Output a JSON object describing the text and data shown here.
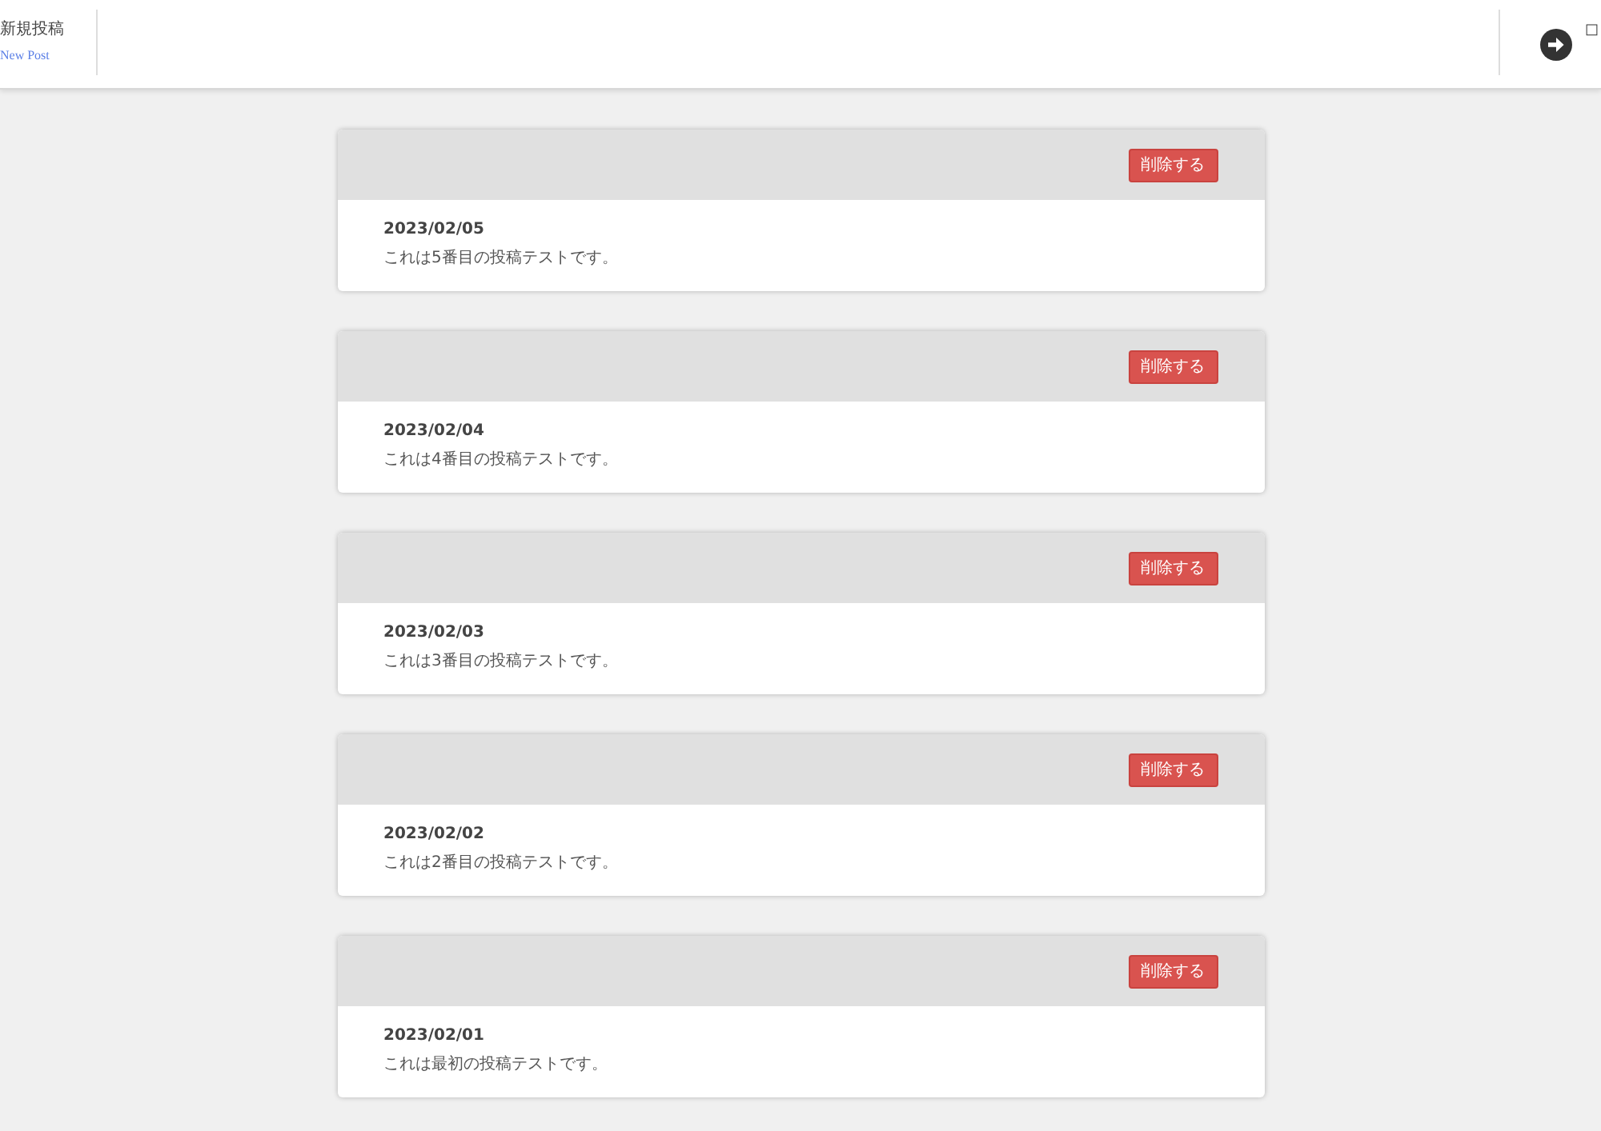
{
  "header": {
    "new_post": {
      "label": "新規投稿",
      "sublabel": "New Post"
    },
    "corner_text": "□"
  },
  "posts": [
    {
      "delete_label": "削除する",
      "date": "2023/02/05",
      "body": "これは5番目の投稿テストです。"
    },
    {
      "delete_label": "削除する",
      "date": "2023/02/04",
      "body": "これは4番目の投稿テストです。"
    },
    {
      "delete_label": "削除する",
      "date": "2023/02/03",
      "body": "これは3番目の投稿テストです。"
    },
    {
      "delete_label": "削除する",
      "date": "2023/02/02",
      "body": "これは2番目の投稿テストです。"
    },
    {
      "delete_label": "削除する",
      "date": "2023/02/01",
      "body": "これは最初の投稿テストです。"
    }
  ]
}
